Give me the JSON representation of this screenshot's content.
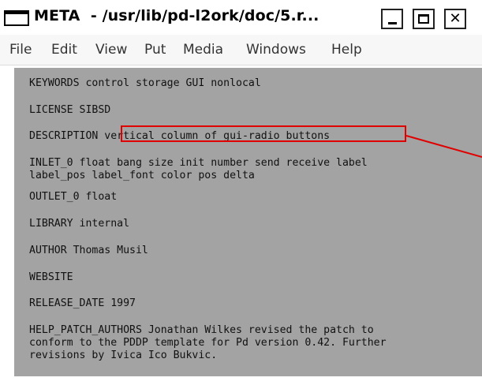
{
  "window": {
    "title": "META  - /usr/lib/pd-l2ork/doc/5.r...",
    "controls": {
      "minimize_icon": "minimize-icon",
      "maximize_icon": "maximize-icon",
      "close_label": "✕"
    }
  },
  "menu": {
    "items": [
      "File",
      "Edit",
      "View",
      "Put",
      "Media",
      "Windows",
      "Help"
    ]
  },
  "meta": {
    "keywords": "KEYWORDS control storage GUI nonlocal",
    "license": "LICENSE SIBSD",
    "description_key": "DESCRIPTION ",
    "description_value": "vertical column of gui-radio buttons",
    "inlet_line1": "INLET_0 float bang size init number send receive label",
    "inlet_line2": "label_pos label_font color pos delta",
    "outlet": "OUTLET_0 float",
    "library": "LIBRARY internal",
    "author": "AUTHOR Thomas Musil",
    "website": "WEBSITE",
    "release_date": "RELEASE_DATE 1997",
    "help_line1": "HELP_PATCH_AUTHORS Jonathan Wilkes revised the patch to",
    "help_line2": "conform to the PDDP template for Pd version 0.42. Further",
    "help_line3": "revisions by Ivica Ico Bukvic."
  },
  "colors": {
    "comment_bg": "#a3a3a3",
    "highlight": "#e00000",
    "menubar_bg": "#f7f7f7"
  }
}
